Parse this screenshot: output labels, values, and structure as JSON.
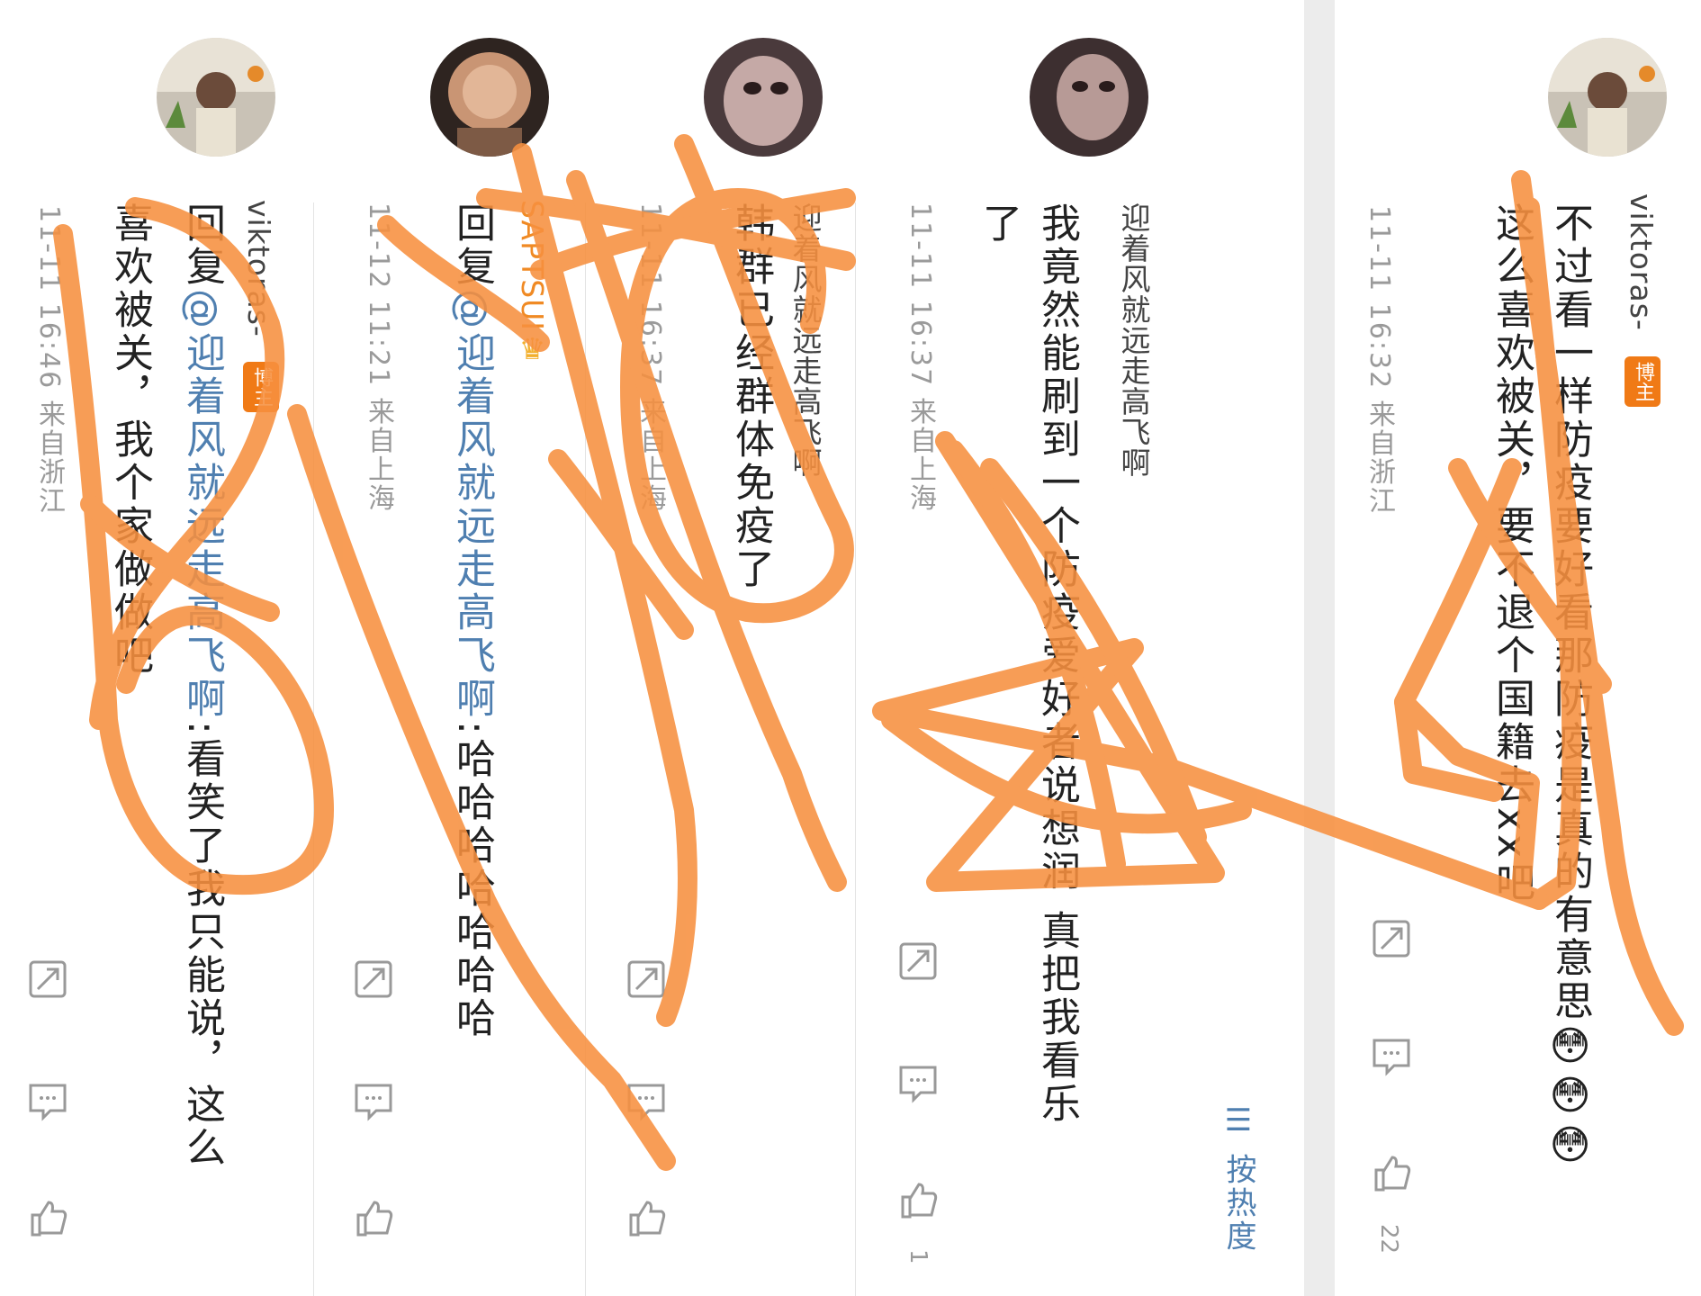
{
  "sort_label": "按热度",
  "comments": [
    {
      "author": "viktoras-",
      "badge": "博主",
      "text": "不过看一样防疫要好看那防疫是真的有意思",
      "text2": "这么喜欢被关，要不退个国籍去xx吧",
      "emojis": [
        "😳",
        "😳",
        "😳"
      ],
      "meta": "11-11 16:32  来自浙江",
      "like_count": "22"
    },
    {
      "author": "迎着风就远走高飞啊",
      "text": "我竟然能刷到一个防疫爱好者说想润 真把我看乐",
      "text2": "了",
      "meta": "11-11 16:37  来自上海",
      "like_count": "1"
    },
    {
      "author": "迎着风就远走高飞啊",
      "text": "韩群已经群体免疫了",
      "meta": "11-11 16:37  来自上海"
    },
    {
      "author": "SAPTSUI",
      "reply_prefix": "回复",
      "mention": "@迎着风就远走高飞啊",
      "text": ":哈哈哈哈哈哈哈",
      "meta": "11-12 11:21  来自上海"
    },
    {
      "author": "viktoras-",
      "badge": "博主",
      "reply_prefix": "回复",
      "mention": "@迎着风就远走高飞啊",
      "text": ":看笑了我只能说，这么",
      "text2": "喜欢被关，我个家做做吧",
      "meta": "11-11 16:46  来自浙江"
    }
  ],
  "colors": {
    "annotation": "#f7903f",
    "link": "#4f7fb0",
    "badge": "#f07a16"
  },
  "icons": [
    "share-icon",
    "comment-icon",
    "like-icon"
  ]
}
